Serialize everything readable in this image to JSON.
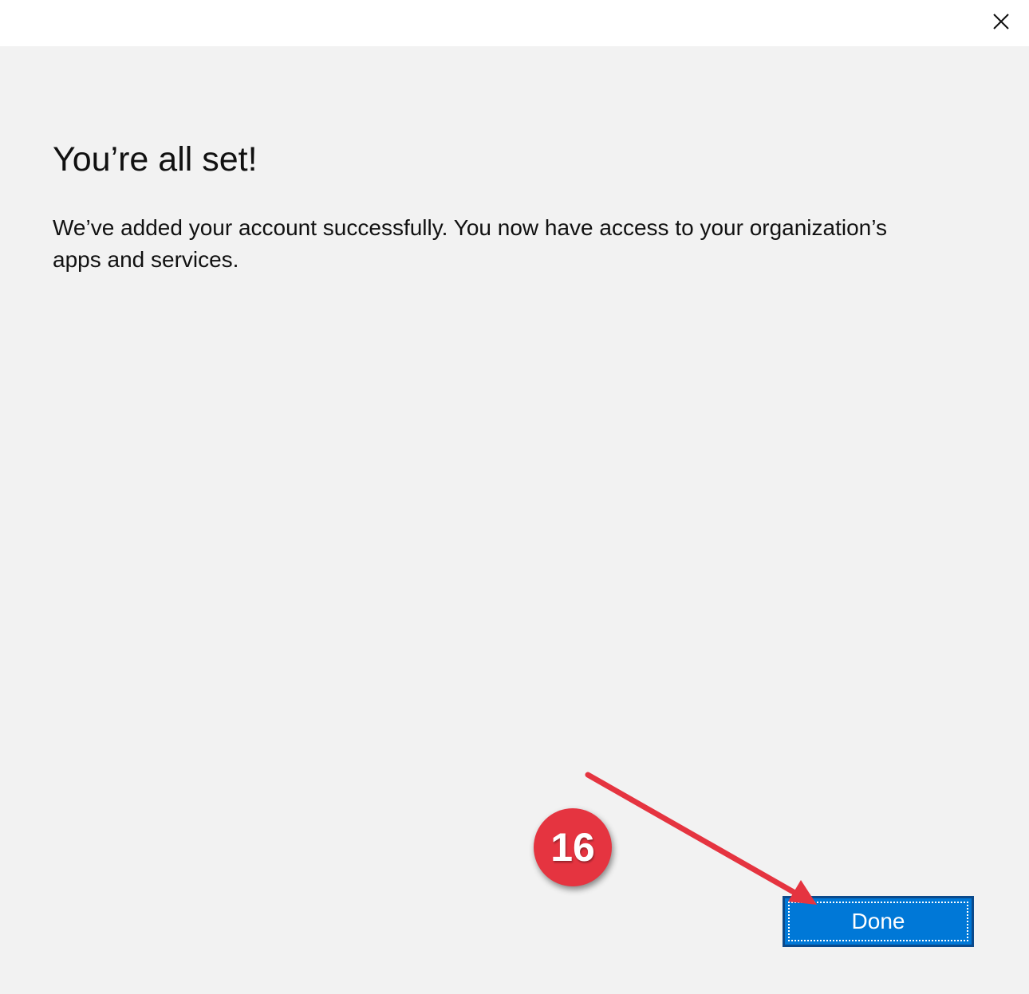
{
  "dialog": {
    "heading": "You’re all set!",
    "message": "We’ve added your account successfully. You now have access to your organization’s apps and services.",
    "done_label": "Done",
    "close_icon": "close-icon"
  },
  "annotation": {
    "step_number": "16",
    "badge_color": "#e53440",
    "arrow_color": "#e53440"
  },
  "colors": {
    "background": "#f2f2f2",
    "titlebar": "#ffffff",
    "accent": "#0078d7"
  }
}
